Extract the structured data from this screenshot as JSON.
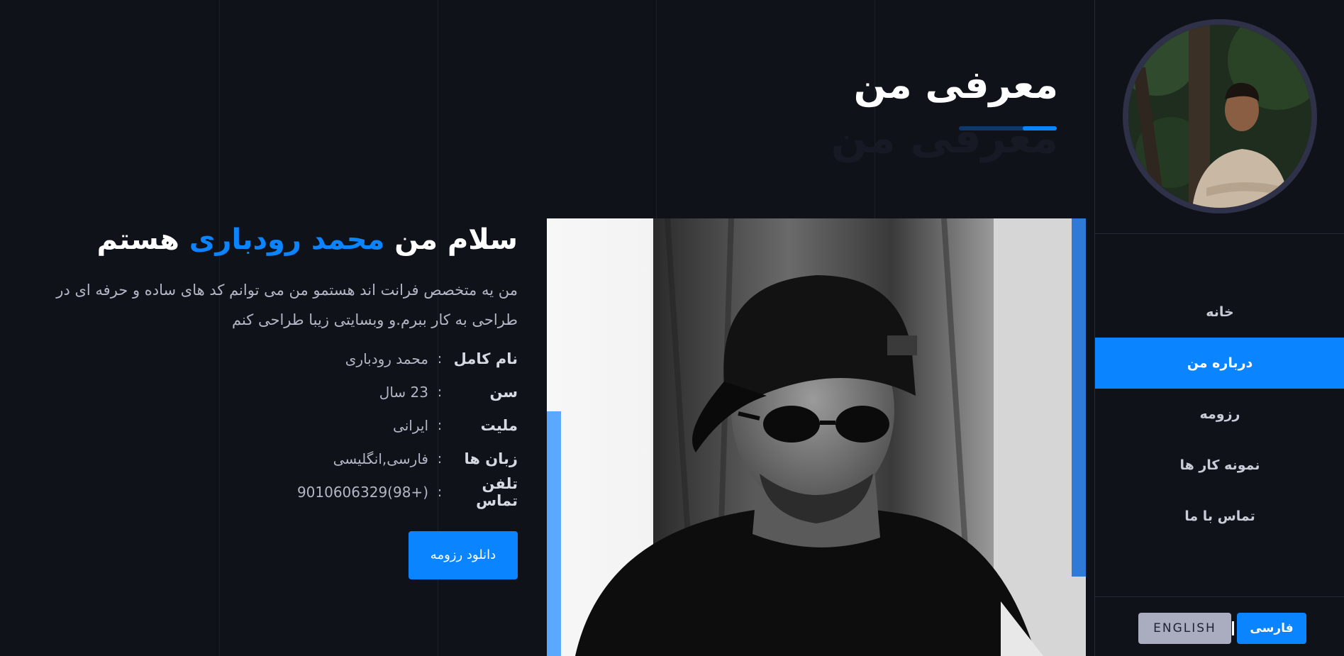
{
  "sidebar": {
    "nav": [
      {
        "label": "خانه",
        "active": false
      },
      {
        "label": "درباره من",
        "active": true
      },
      {
        "label": "رزومه",
        "active": false
      },
      {
        "label": "نمونه کار ها",
        "active": false
      },
      {
        "label": "تماس با ما",
        "active": false
      }
    ],
    "lang_en": "ENGLISH",
    "lang_fa": "فارسی"
  },
  "section": {
    "title": "معرفی من",
    "ghost_title": "معرفی من"
  },
  "intro": {
    "greeting_prefix": "سلام من",
    "greeting_name": "محمد رودباری",
    "greeting_suffix": "هستم",
    "bio": "من یه متخصص فرانت اند هستمو من می توانم کد های ساده و حرفه ای در طراحی به کار ببرم.و وبسایتی زیبا طراحی کنم",
    "info": [
      {
        "label": "نام کامل",
        "value": "محمد رودباری"
      },
      {
        "label": "سن",
        "value": "23 سال"
      },
      {
        "label": "ملیت",
        "value": "ایرانی"
      },
      {
        "label": "زبان ها",
        "value": "فارسی,انگلیسی"
      },
      {
        "label": "تلفن تماس",
        "value": "9010606329(98+)"
      }
    ],
    "colon": ":",
    "download_label": "دانلود رزومه"
  },
  "colors": {
    "accent": "#0a84ff",
    "background": "#10121a"
  }
}
